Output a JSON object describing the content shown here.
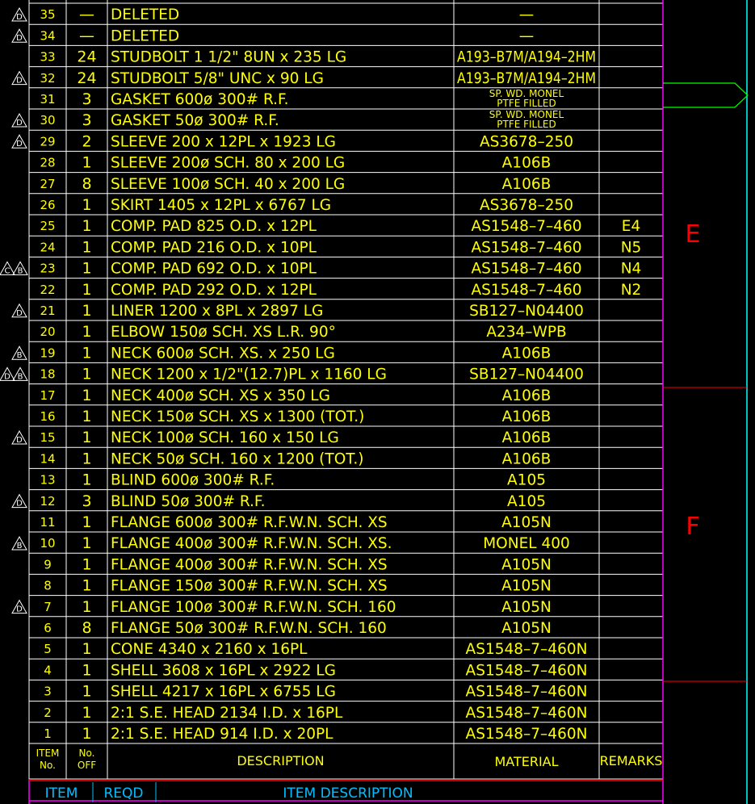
{
  "bom": {
    "rows": [
      {
        "item": "35",
        "qty": "—",
        "desc": "DELETED",
        "material": "—",
        "remarks": "",
        "rev": "D"
      },
      {
        "item": "34",
        "qty": "—",
        "desc": "DELETED",
        "material": "—",
        "remarks": "",
        "rev": "D"
      },
      {
        "item": "33",
        "qty": "24",
        "desc": "STUDBOLT   1 1/2\"  8UN  x  235  LG",
        "material": "A193–B7M/A194–2HM",
        "remarks": "",
        "rev": ""
      },
      {
        "item": "32",
        "qty": "24",
        "desc": "STUDBOLT   5/8\"  UNC  x  90  LG",
        "material": "A193–B7M/A194–2HM",
        "remarks": "",
        "rev": "D"
      },
      {
        "item": "31",
        "qty": "3",
        "desc": "GASKET   600ø  300#  R.F.",
        "material": "SP. WD. MONEL|PTFE FILLED",
        "remarks": "",
        "rev": ""
      },
      {
        "item": "30",
        "qty": "3",
        "desc": "GASKET   50ø  300#  R.F.",
        "material": "SP. WD. MONEL|PTFE FILLED",
        "remarks": "",
        "rev": "D"
      },
      {
        "item": "29",
        "qty": "2",
        "desc": "SLEEVE   200  x  12PL  x  1923  LG",
        "material": "AS3678–250",
        "remarks": "",
        "rev": "D"
      },
      {
        "item": "28",
        "qty": "1",
        "desc": "SLEEVE   200ø  SCH.  80  x  200  LG",
        "material": "A106B",
        "remarks": "",
        "rev": ""
      },
      {
        "item": "27",
        "qty": "8",
        "desc": "SLEEVE   100ø  SCH.  40  x  200  LG",
        "material": "A106B",
        "remarks": "",
        "rev": ""
      },
      {
        "item": "26",
        "qty": "1",
        "desc": "SKIRT   1405  x  12PL  x  6767  LG",
        "material": "AS3678–250",
        "remarks": "",
        "rev": ""
      },
      {
        "item": "25",
        "qty": "1",
        "desc": "COMP.  PAD   825  O.D.  x  12PL",
        "material": "AS1548–7–460",
        "remarks": "E4",
        "rev": ""
      },
      {
        "item": "24",
        "qty": "1",
        "desc": "COMP.  PAD   216  O.D.  x  10PL",
        "material": "AS1548–7–460",
        "remarks": "N5",
        "rev": ""
      },
      {
        "item": "23",
        "qty": "1",
        "desc": "COMP.  PAD   692  O.D.  x  10PL",
        "material": "AS1548–7–460",
        "remarks": "N4",
        "rev": "CB"
      },
      {
        "item": "22",
        "qty": "1",
        "desc": "COMP.  PAD   292  O.D.  x  12PL",
        "material": "AS1548–7–460",
        "remarks": "N2",
        "rev": ""
      },
      {
        "item": "21",
        "qty": "1",
        "desc": "LINER  1200  x  8PL  x  2897  LG",
        "material": "SB127–N04400",
        "remarks": "",
        "rev": "D"
      },
      {
        "item": "20",
        "qty": "1",
        "desc": "ELBOW   150ø  SCH.  XS   L.R.  90°",
        "material": "A234–WPB",
        "remarks": "",
        "rev": ""
      },
      {
        "item": "19",
        "qty": "1",
        "desc": "NECK   600ø  SCH.  XS.  x  250  LG",
        "material": "A106B",
        "remarks": "",
        "rev": "B"
      },
      {
        "item": "18",
        "qty": "1",
        "desc": "NECK   1200  x  1/2\"(12.7)PL  x  1160  LG",
        "material": "SB127–N04400",
        "remarks": "",
        "rev": "DB"
      },
      {
        "item": "17",
        "qty": "1",
        "desc": "NECK   400ø  SCH.  XS  x  350  LG",
        "material": "A106B",
        "remarks": "",
        "rev": ""
      },
      {
        "item": "16",
        "qty": "1",
        "desc": "NECK   150ø  SCH.  XS  x  1300  (TOT.)",
        "material": "A106B",
        "remarks": "",
        "rev": ""
      },
      {
        "item": "15",
        "qty": "1",
        "desc": "NECK   100ø  SCH.  160  x  150  LG",
        "material": "A106B",
        "remarks": "",
        "rev": "D"
      },
      {
        "item": "14",
        "qty": "1",
        "desc": "NECK   50ø  SCH.  160  x  1200  (TOT.)",
        "material": "A106B",
        "remarks": "",
        "rev": ""
      },
      {
        "item": "13",
        "qty": "1",
        "desc": "BLIND   600ø  300#  R.F.",
        "material": "A105",
        "remarks": "",
        "rev": ""
      },
      {
        "item": "12",
        "qty": "3",
        "desc": "BLIND   50ø  300#  R.F.",
        "material": "A105",
        "remarks": "",
        "rev": "D"
      },
      {
        "item": "11",
        "qty": "1",
        "desc": "FLANGE   600ø  300#  R.F.W.N.    SCH.  XS",
        "material": "A105N",
        "remarks": "",
        "rev": ""
      },
      {
        "item": "10",
        "qty": "1",
        "desc": "FLANGE   400ø  300#  R.F.W.N.    SCH.  XS.",
        "material": "MONEL  400",
        "remarks": "",
        "rev": "B"
      },
      {
        "item": "9",
        "qty": "1",
        "desc": "FLANGE   400ø  300#  R.F.W.N.    SCH.  XS",
        "material": "A105N",
        "remarks": "",
        "rev": ""
      },
      {
        "item": "8",
        "qty": "1",
        "desc": "FLANGE   150ø  300#  R.F.W.N.    SCH.  XS",
        "material": "A105N",
        "remarks": "",
        "rev": ""
      },
      {
        "item": "7",
        "qty": "1",
        "desc": "FLANGE   100ø  300#  R.F.W.N.    SCH.  160",
        "material": "A105N",
        "remarks": "",
        "rev": "D"
      },
      {
        "item": "6",
        "qty": "8",
        "desc": "FLANGE   50ø  300#  R.F.W.N.    SCH.  160",
        "material": "A105N",
        "remarks": "",
        "rev": ""
      },
      {
        "item": "5",
        "qty": "1",
        "desc": "CONE   4340  x  2160  x  16PL",
        "material": "AS1548–7–460N",
        "remarks": "",
        "rev": ""
      },
      {
        "item": "4",
        "qty": "1",
        "desc": "SHELL   3608  x  16PL  x  2922  LG",
        "material": "AS1548–7–460N",
        "remarks": "",
        "rev": ""
      },
      {
        "item": "3",
        "qty": "1",
        "desc": "SHELL   4217  x  16PL  x  6755  LG",
        "material": "AS1548–7–460N",
        "remarks": "",
        "rev": ""
      },
      {
        "item": "2",
        "qty": "1",
        "desc": "2:1  S.E.  HEAD   2134  I.D.  x  16PL",
        "material": "AS1548–7–460N",
        "remarks": "",
        "rev": ""
      },
      {
        "item": "1",
        "qty": "1",
        "desc": "2:1  S.E.  HEAD   914  I.D.  x  20PL",
        "material": "AS1548–7–460N",
        "remarks": "",
        "rev": ""
      }
    ],
    "header": {
      "item_line1": "ITEM",
      "item_line2": "No.",
      "qty_line1": "No.",
      "qty_line2": "OFF",
      "description": "DESCRIPTION",
      "material": "MATERIAL",
      "remarks": "REMARKS"
    },
    "footer": {
      "item": "ITEM",
      "reqd": "REQD",
      "description": "ITEM  DESCRIPTION"
    }
  },
  "zones": [
    "E",
    "F"
  ],
  "colors": {
    "grid": "#ffffff",
    "text": "#ffff00",
    "magenta": "#ff00ff",
    "red": "#ff0000",
    "cyan": "#00ffff",
    "green": "#00ff00",
    "footer_text": "#00bfff"
  }
}
